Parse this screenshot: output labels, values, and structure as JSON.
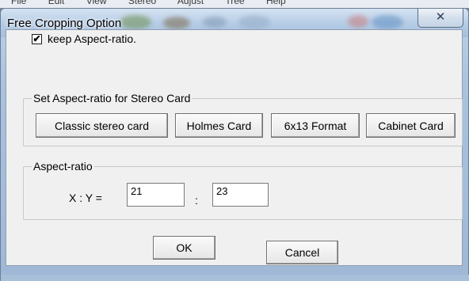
{
  "background_menu": [
    "File",
    "Edit",
    "View",
    "Stereo",
    "Adjust",
    "Tree",
    "Help"
  ],
  "dialog": {
    "title": "Free Cropping Option",
    "close_glyph": "✕"
  },
  "options": {
    "keep_aspect_ratio_label": "keep Aspect-ratio.",
    "keep_aspect_ratio_checked": true,
    "check_glyph": "✔"
  },
  "stereo_card_group": {
    "legend": "Set Aspect-ratio for Stereo Card",
    "buttons": [
      "Classic stereo card",
      "Holmes Card",
      "6x13 Format",
      "Cabinet Card"
    ]
  },
  "aspect_ratio_group": {
    "legend": "Aspect-ratio",
    "xy_label": "X : Y =",
    "separator": ":",
    "x_value": "21",
    "y_value": "23"
  },
  "footer": {
    "ok_label": "OK",
    "cancel_label": "Cancel"
  }
}
